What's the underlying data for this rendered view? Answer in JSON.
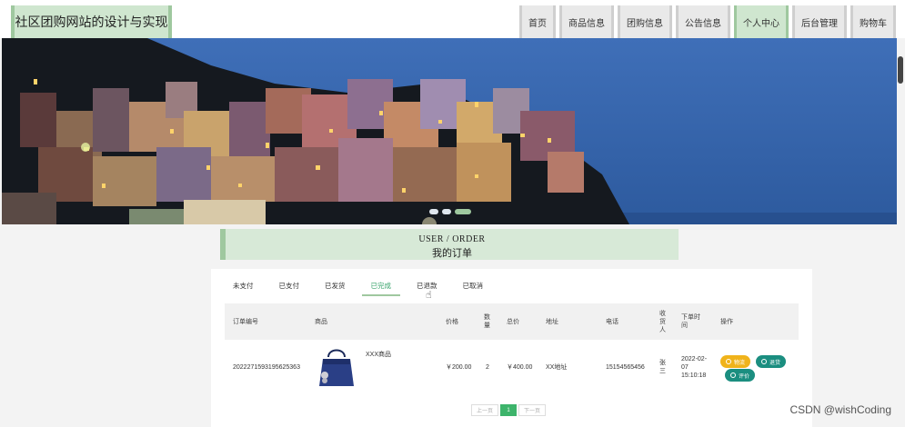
{
  "header": {
    "site_title": "社区团购网站的设计与实现",
    "nav": [
      "首页",
      "商品信息",
      "团购信息",
      "公告信息",
      "个人中心",
      "后台管理",
      "购物车"
    ],
    "active_nav": "个人中心"
  },
  "section": {
    "title_en": "USER / ORDER",
    "title_cn": "我的订单"
  },
  "tabs": [
    "未支付",
    "已支付",
    "已发货",
    "已完成",
    "已退款",
    "已取消"
  ],
  "active_tab": "已完成",
  "table": {
    "headers": {
      "order_no": "订单编号",
      "product": "商品",
      "price": "价格",
      "quantity": "数量",
      "total": "总价",
      "address": "地址",
      "phone": "电话",
      "recipient": "收货人",
      "order_time": "下单时间",
      "actions": "操作"
    },
    "rows": [
      {
        "order_no": "2022271593195625363",
        "product_name": "XXX商品",
        "price": "￥200.00",
        "quantity": "2",
        "total": "￥400.00",
        "address": "XX地址",
        "phone": "15154565456",
        "recipient": "张三",
        "order_time": "2022-02-07 15:10:18",
        "actions": [
          "物流",
          "退货",
          "评价"
        ]
      }
    ]
  },
  "pager": {
    "prev": "上一页",
    "current": "1",
    "next": "下一页"
  },
  "watermark": "CSDN @wishCoding",
  "colors": {
    "accent_green": "#cfe6cf",
    "border_green": "#9fc89f",
    "active_page": "#3db46b",
    "btn_yellow": "#f0b31b",
    "btn_teal": "#1b8e80"
  }
}
